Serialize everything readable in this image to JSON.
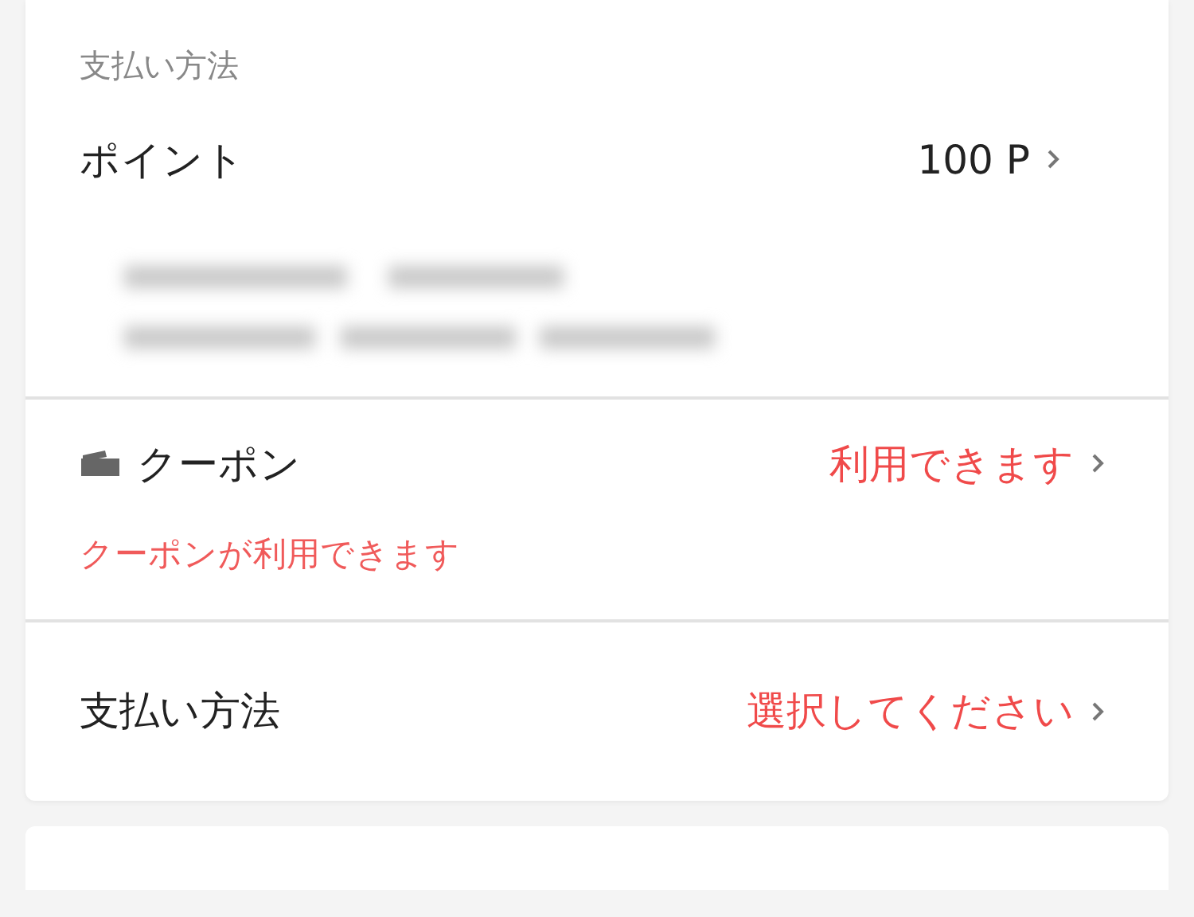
{
  "payment_card": {
    "section_title": "支払い方法",
    "points": {
      "label": "ポイント",
      "value": "100 P"
    },
    "coupon": {
      "label": "クーポン",
      "value": "利用できます",
      "alert": true,
      "notice": "クーポンが利用できます"
    },
    "payment_method": {
      "label": "支払い方法",
      "value": "選択してください",
      "alert": true
    }
  }
}
